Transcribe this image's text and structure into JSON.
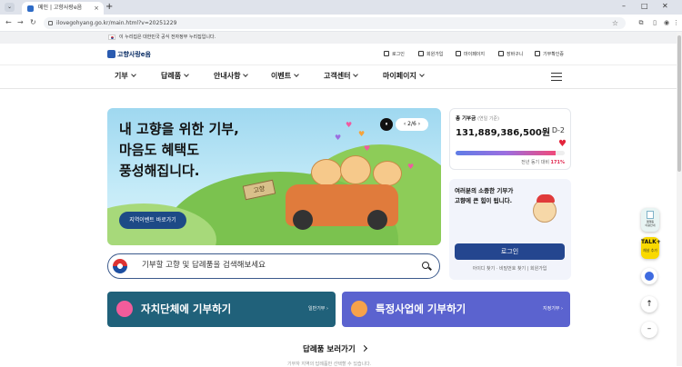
{
  "browser": {
    "tab_title": "메인 | 고향사랑e음",
    "url": "ilovegohyang.go.kr/main.html?v=20251229"
  },
  "gov_bar": {
    "text": "이 누리집은 대한민국 공식 전자정부 누리집입니다."
  },
  "header": {
    "logo": "고향사랑e음",
    "util": [
      "로그인",
      "회원가입",
      "마이페이지",
      "장바구니",
      "기부확인증"
    ]
  },
  "gnb": [
    "기부",
    "답례품",
    "안내사항",
    "이벤트",
    "고객센터",
    "마이페이지"
  ],
  "banner": {
    "headline": "내 고향을 위한 기부,\n마음도 혜택도\n풍성해집니다.",
    "button": "지역이벤트 바로가기",
    "sign": "고향",
    "pager": "2 / 6",
    "pause_icon": "⏸",
    "nav": "‹ 2/6 ›"
  },
  "stats": {
    "label": "총 기부금",
    "label_note": "(연일 기준)",
    "amount": "131,889,386,500원",
    "dday": "D-2",
    "progress": 0.92,
    "rate_label": "전년 동기 대비",
    "rate": "171%"
  },
  "login_box": {
    "message": "여러분의 소중한 기부가\n고향에 큰 힘이 됩니다.",
    "button": "로그인",
    "links": "아이디 찾기 · 비밀번호 찾기  |  회원가입"
  },
  "search": {
    "placeholder": "기부할 고향 및 답례품을 검색해보세요"
  },
  "cta": [
    {
      "title": "자치단체에 기부하기",
      "sub": "일반기부 ›",
      "color": "#20617a"
    },
    {
      "title": "특정사업에 기부하기",
      "sub": "지정기부 ›",
      "color": "#5b63cf"
    }
  ],
  "gifts": {
    "title": "답례품 보러가기",
    "caption": "기부자 지역의 답례품만 선택할 수 있습니다."
  },
  "floating": {
    "guide": "결재동\n이용안내",
    "kakao": "채널 추가"
  }
}
